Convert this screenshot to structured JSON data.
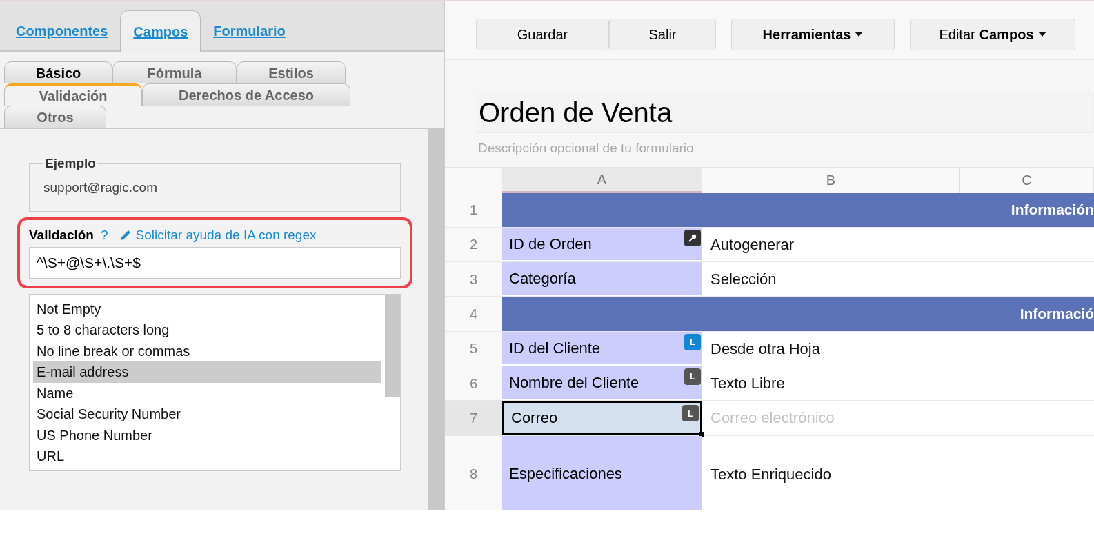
{
  "main_tabs": [
    {
      "label": "Componentes",
      "selected": false
    },
    {
      "label": "Campos",
      "selected": true
    },
    {
      "label": "Formulario",
      "selected": false
    }
  ],
  "sub_tabs": [
    [
      {
        "label": "Básico",
        "selected": false,
        "highlighted": true
      },
      {
        "label": "Fórmula",
        "selected": false,
        "highlighted": false
      },
      {
        "label": "Estilos",
        "selected": false,
        "highlighted": false
      }
    ],
    [
      {
        "label": "Validación",
        "selected": true,
        "highlighted": false
      },
      {
        "label": "Derechos de Acceso",
        "selected": false,
        "highlighted": false
      }
    ],
    [
      {
        "label": "Otros",
        "selected": false,
        "highlighted": false
      }
    ]
  ],
  "example": {
    "legend": "Ejemplo",
    "value": "support@ragic.com"
  },
  "validation": {
    "label": "Validación",
    "help": "?",
    "ai_link": "Solicitar ayuda de IA con regex",
    "value": "^\\S+@\\S+\\.\\S+$"
  },
  "presets": [
    {
      "label": "Not Empty",
      "selected": false
    },
    {
      "label": "5 to 8 characters long",
      "selected": false
    },
    {
      "label": "No line break or commas",
      "selected": false
    },
    {
      "label": "E-mail address",
      "selected": true
    },
    {
      "label": "Name",
      "selected": false
    },
    {
      "label": "Social Security Number",
      "selected": false
    },
    {
      "label": "US Phone Number",
      "selected": false
    },
    {
      "label": "URL",
      "selected": false
    }
  ],
  "toolbar": [
    {
      "kind": "plain",
      "label": "Guardar"
    },
    {
      "kind": "plain",
      "label": "Salir"
    },
    {
      "kind": "menu",
      "label": "Herramientas"
    },
    {
      "kind": "menu",
      "prefix": "Editar",
      "label": "Campos"
    }
  ],
  "form": {
    "title": "Orden de Venta",
    "description_placeholder": "Descripción opcional de tu formulario"
  },
  "columns": [
    "A",
    "B",
    "C"
  ],
  "rows": [
    {
      "number": "1",
      "kind": "section",
      "text": "Información",
      "selected": false
    },
    {
      "number": "2",
      "kind": "field",
      "label": "ID de Orden",
      "badge": {
        "kind": "key"
      },
      "value": "Autogenerar",
      "muted": false,
      "selected": false
    },
    {
      "number": "3",
      "kind": "field",
      "label": "Categoría",
      "value": "Selección",
      "muted": false,
      "selected": false
    },
    {
      "number": "4",
      "kind": "section",
      "text": "Informació",
      "selected": false
    },
    {
      "number": "5",
      "kind": "field",
      "label": "ID del Cliente",
      "badge": {
        "kind": "letter",
        "text": "L",
        "color": "#1187d4"
      },
      "value": "Desde otra Hoja",
      "muted": false,
      "selected": false
    },
    {
      "number": "6",
      "kind": "field",
      "label": "Nombre del Cliente",
      "badge": {
        "kind": "letter",
        "text": "L",
        "color": "#555555"
      },
      "value": "Texto Libre",
      "muted": false,
      "selected": false
    },
    {
      "number": "7",
      "kind": "field",
      "label": "Correo",
      "badge": {
        "kind": "letter",
        "text": "L",
        "color": "#555555"
      },
      "value": "Correo electrónico",
      "muted": true,
      "selected": true
    },
    {
      "number": "8",
      "kind": "tall",
      "label": "Especificaciones",
      "value": "Texto Enriquecido",
      "muted": false,
      "selected": false
    }
  ]
}
